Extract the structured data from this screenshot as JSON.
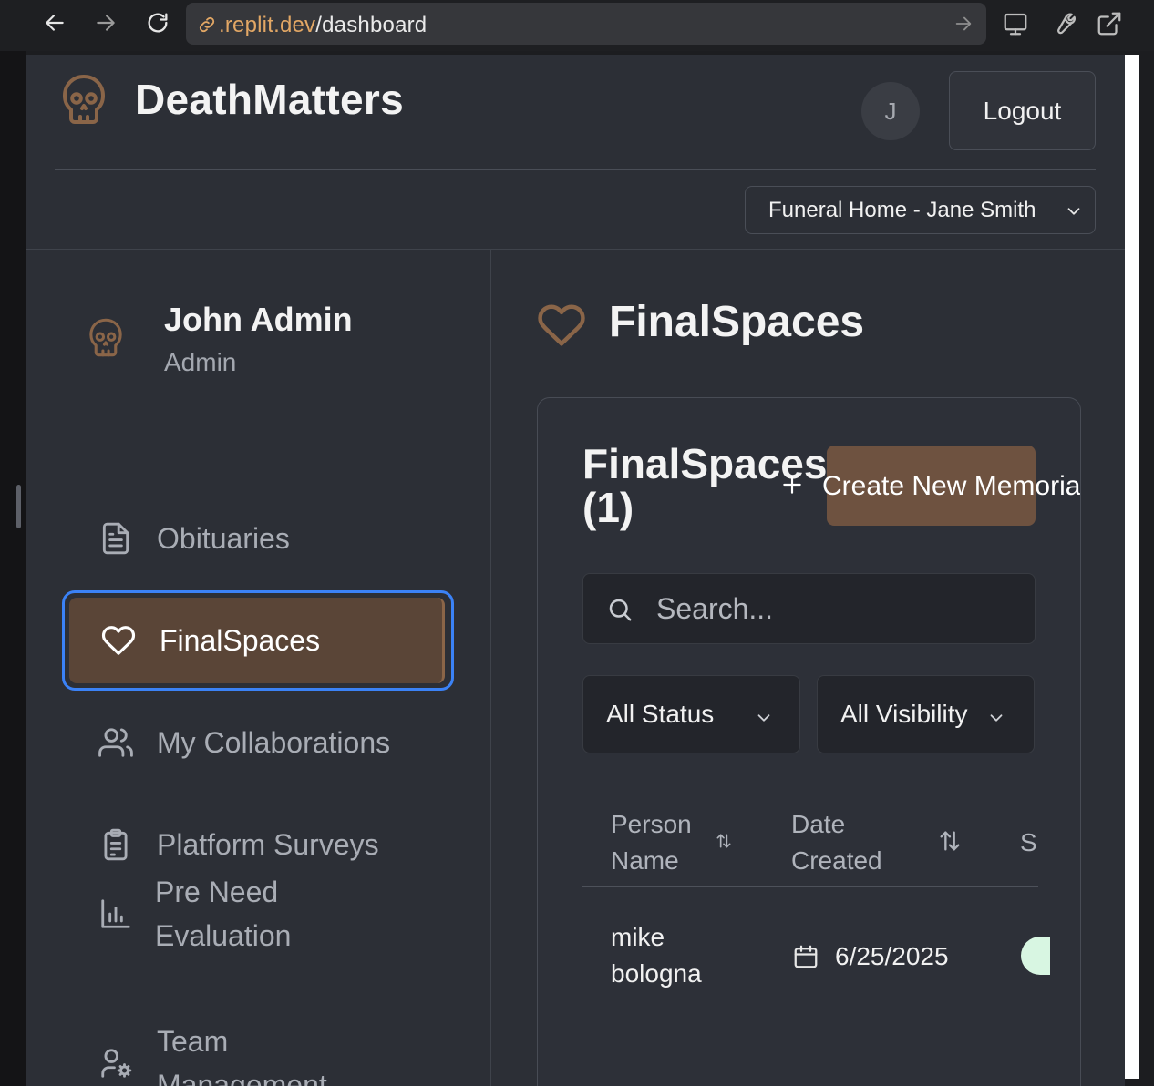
{
  "browser": {
    "url_domain": ".replit.dev",
    "url_path": "/dashboard"
  },
  "header": {
    "brand": "DeathMatters",
    "avatar_initial": "J",
    "logout_label": "Logout",
    "org_selected": "Funeral Home - Jane Smith"
  },
  "sidebar": {
    "user_name": "John Admin",
    "user_role": "Admin",
    "items": [
      {
        "label": "Obituaries",
        "icon": "document-icon",
        "active": false
      },
      {
        "label": "FinalSpaces",
        "icon": "heart-icon",
        "active": true
      },
      {
        "label": "My Collaborations",
        "icon": "users-icon",
        "active": false
      },
      {
        "label": "Platform Surveys",
        "icon": "clipboard-icon",
        "active": false
      },
      {
        "label": "Pre Need Evaluation",
        "icon": "bar-chart-icon",
        "active": false
      },
      {
        "label": "Team Management",
        "icon": "user-gear-icon",
        "active": false
      }
    ]
  },
  "main": {
    "page_title": "FinalSpaces",
    "card_title": "FinalSpaces (1)",
    "create_label": "Create New Memorial",
    "search_placeholder": "Search...",
    "filters": {
      "status": "All Status",
      "visibility": "All Visibility"
    },
    "table": {
      "headers": [
        "Person Name",
        "Date Created",
        "S"
      ],
      "rows": [
        {
          "person_name": "mike bologna",
          "date_created": "6/25/2025"
        }
      ]
    }
  },
  "colors": {
    "accent_brown": "#6e5240",
    "active_item": "#5a4537",
    "focus_ring": "#3b82f6",
    "background": "#2c2f36",
    "status_badge": "#d8f6e2"
  }
}
